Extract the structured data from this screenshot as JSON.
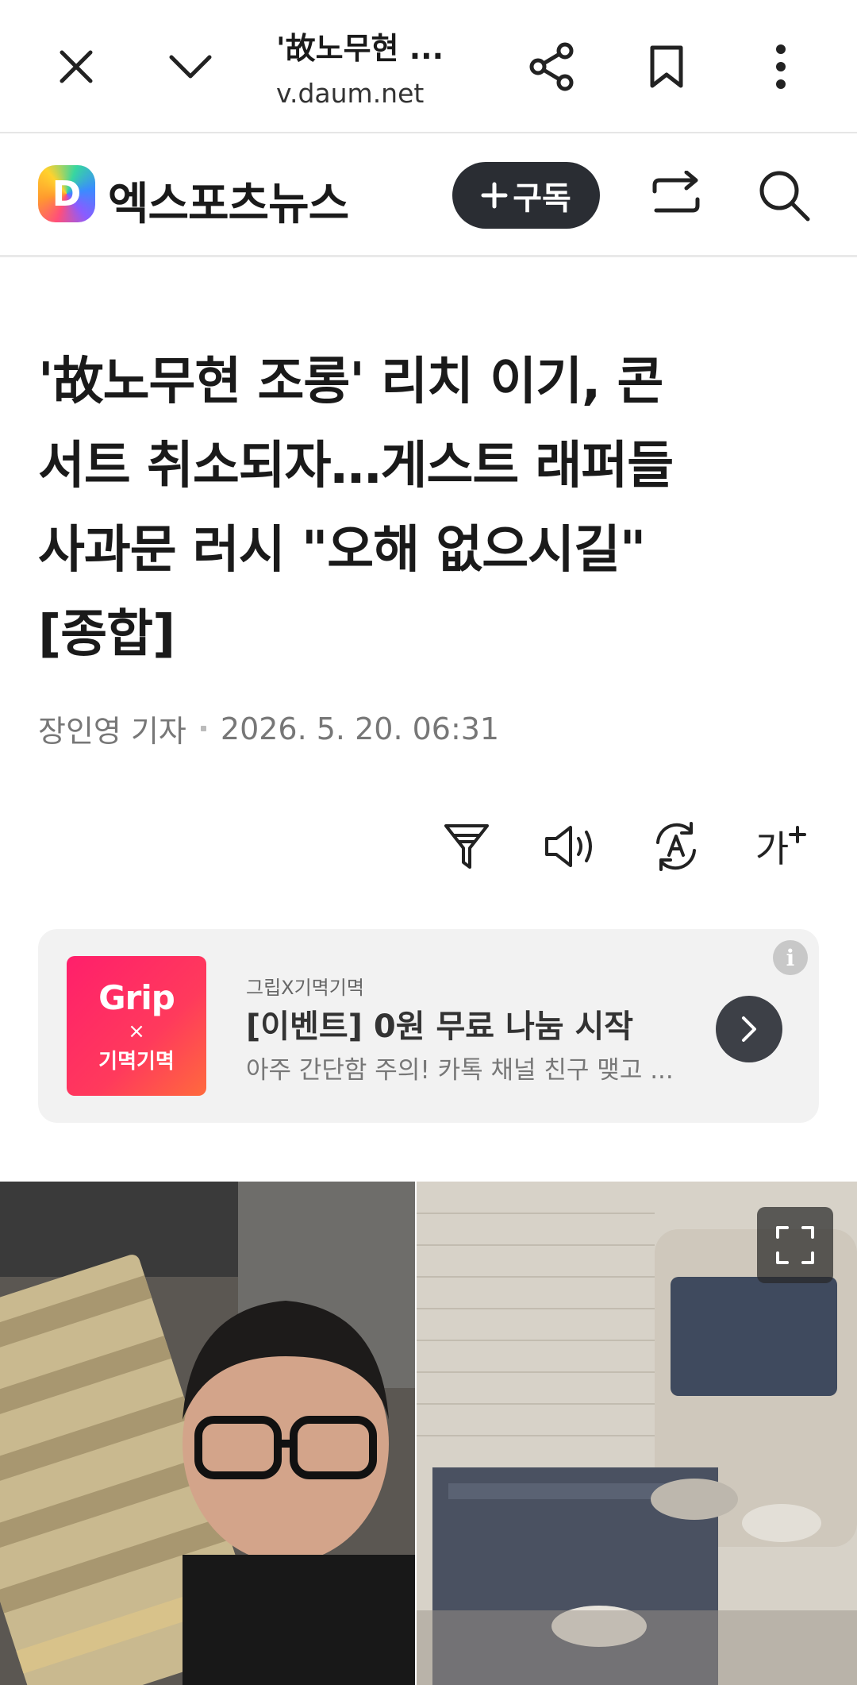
{
  "browser": {
    "title": "'故노무현 ...",
    "url": "v.daum.net"
  },
  "site": {
    "logo_letter": "D",
    "name": "엑스포츠뉴스",
    "subscribe_label": "구독"
  },
  "article": {
    "headline_lines": [
      "'故노무현 조롱' 리치 이기, 콘",
      "서트 취소되자…게스트 래퍼들",
      "사과문 러시 \"오해 없으시길\"",
      "[종합]"
    ],
    "author": "장인영 기자",
    "datetime": "2026. 5. 20. 06:31",
    "font_tool_label": "가"
  },
  "ad": {
    "thumb_brand": "Grip",
    "thumb_x": "×",
    "thumb_partner": "기멱기멱",
    "source": "그립X기멱기멱",
    "title": "[이벤트] 0원 무료 나눔 시작",
    "description": "아주 간단함 주의! 카톡 채널 친구 맺고 ...",
    "info_label": "i"
  },
  "photo": {
    "alt": "article photo"
  },
  "colors": {
    "subscribe_bg": "#2a2d33",
    "ad_bg": "#f2f2f2",
    "ad_thumb": "#ff1f6b"
  }
}
